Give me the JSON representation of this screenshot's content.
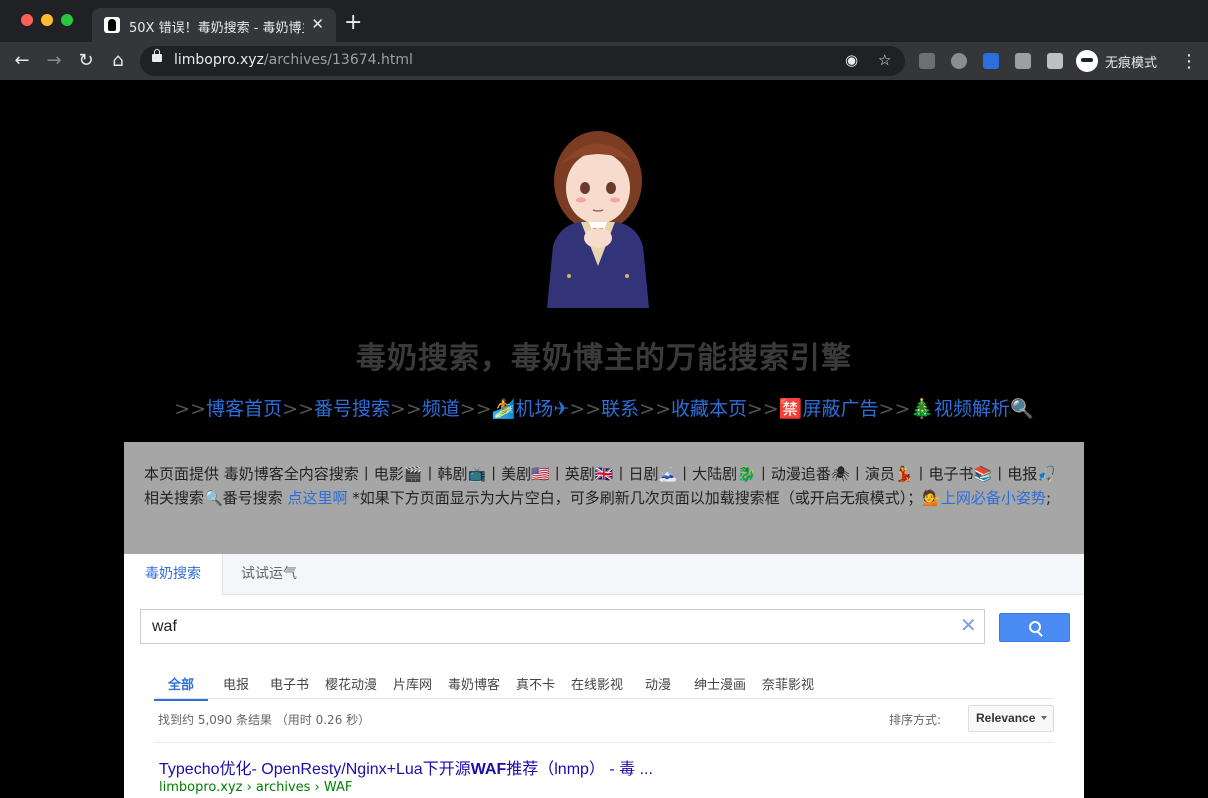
{
  "browser": {
    "tab_title": "50X 错误！毒奶搜索 - 毒奶博主的万能搜索引擎",
    "url_host": "limbopro.xyz",
    "url_path": "/archives/13674.html",
    "incognito_label": "无痕模式"
  },
  "site": {
    "title": "毒奶搜索，毒奶博主的万能搜索引擎",
    "nav": {
      "sep": ">>",
      "blog_home": "博客首页",
      "fanhao_search": "番号搜索",
      "channels": "频道",
      "airport": "🏄机场✈",
      "contact": "联系",
      "bookmark": "收藏本页",
      "block_ads": "🈲屏蔽广告",
      "video_parse": "🎄视频解析🔍"
    },
    "info": {
      "intro": "本页面提供 毒奶博客全内容搜索丨电影🎬丨韩剧📺丨美剧🇺🇸丨英剧🇬🇧丨日剧🗻丨大陆剧🐉丨动漫追番🕷丨演员💃丨电子书📚丨电报🎣相关搜索🔍番号搜索 ",
      "click_here": "点这里啊",
      "tip": " *如果下方页面显示为大片空白，可多刷新几次页面以加载搜索框（或开启无痕模式）；",
      "tips_link": "💁上网必备小姿势",
      "tail": ";"
    }
  },
  "search": {
    "tabs": [
      "毒奶搜索",
      "试试运气"
    ],
    "query": "waf",
    "refinements": [
      "全部",
      "电报",
      "电子书",
      "樱花动漫",
      "片库网",
      "毒奶博客",
      "真不卡",
      "在线影视",
      "动漫",
      "绅士漫画",
      "奈菲影视"
    ],
    "stats": "找到约 5,090 条结果 （用时 0.26 秒）",
    "sort_label": "排序方式:",
    "sort_value": "Relevance",
    "results": [
      {
        "title_pre": "Typecho优化- OpenResty/Nginx+Lua下开源",
        "title_bold": "WAF",
        "title_post": "推荐（lnmp） - 毒 ...",
        "url": "limbopro.xyz › archives › WAF"
      }
    ]
  }
}
